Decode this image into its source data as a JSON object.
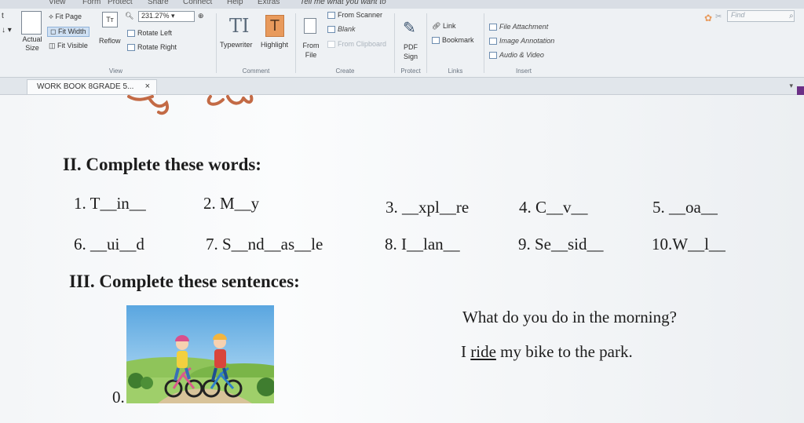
{
  "menu": [
    "View",
    "Form",
    "Protect",
    "Share",
    "Connect",
    "Help",
    "Extras",
    "Tell me what you want to"
  ],
  "ribbon": {
    "view_group": {
      "actual_size": "Actual Size",
      "fit_page": "Fit Page",
      "fit_width": "Fit Width",
      "fit_visible": "Fit Visible",
      "reflow": "Reflow",
      "zoom_value": "231.27%",
      "rotate_left": "Rotate Left",
      "rotate_right": "Rotate Right",
      "label": "View"
    },
    "comment_group": {
      "typewriter": "Typewriter",
      "highlight": "Highlight",
      "label": "Comment"
    },
    "create_group": {
      "from_file": "From File",
      "from_scanner": "From Scanner",
      "blank": "Blank",
      "from_clipboard": "From Clipboard",
      "label": "Create"
    },
    "protect_group": {
      "pdf_sign": "PDF Sign",
      "label": "Protect"
    },
    "links_group": {
      "link": "Link",
      "bookmark": "Bookmark",
      "label": "Links"
    },
    "insert_group": {
      "file_attachment": "File Attachment",
      "image_annotation": "Image Annotation",
      "audio_video": "Audio & Video",
      "label": "Insert"
    },
    "find_placeholder": "Find"
  },
  "tab": {
    "title": "WORK BOOK 8GRADE 5...",
    "close": "×"
  },
  "document": {
    "section2_title": "II. Complete these words:",
    "words": [
      "1. T__in__",
      "2. M__y",
      "3. __xpl__re",
      "4. C__v__",
      "5. __oa__",
      "6. __ui__d",
      "7. S__nd__as__le",
      "8. I__lan__",
      "9. Se__sid__",
      "10.W__l__"
    ],
    "section3_title": "III. Complete these sentences:",
    "question": "What do  you  do in the morning?",
    "answer_pre": "I ",
    "answer_underlined": "ride",
    "answer_post": " my bike to the park.",
    "item_number": "0."
  },
  "colors": {
    "accent_purple": "#6b2f86",
    "highlight_orange": "#e89a5c",
    "ribbon_bg": "#eef1f4"
  }
}
